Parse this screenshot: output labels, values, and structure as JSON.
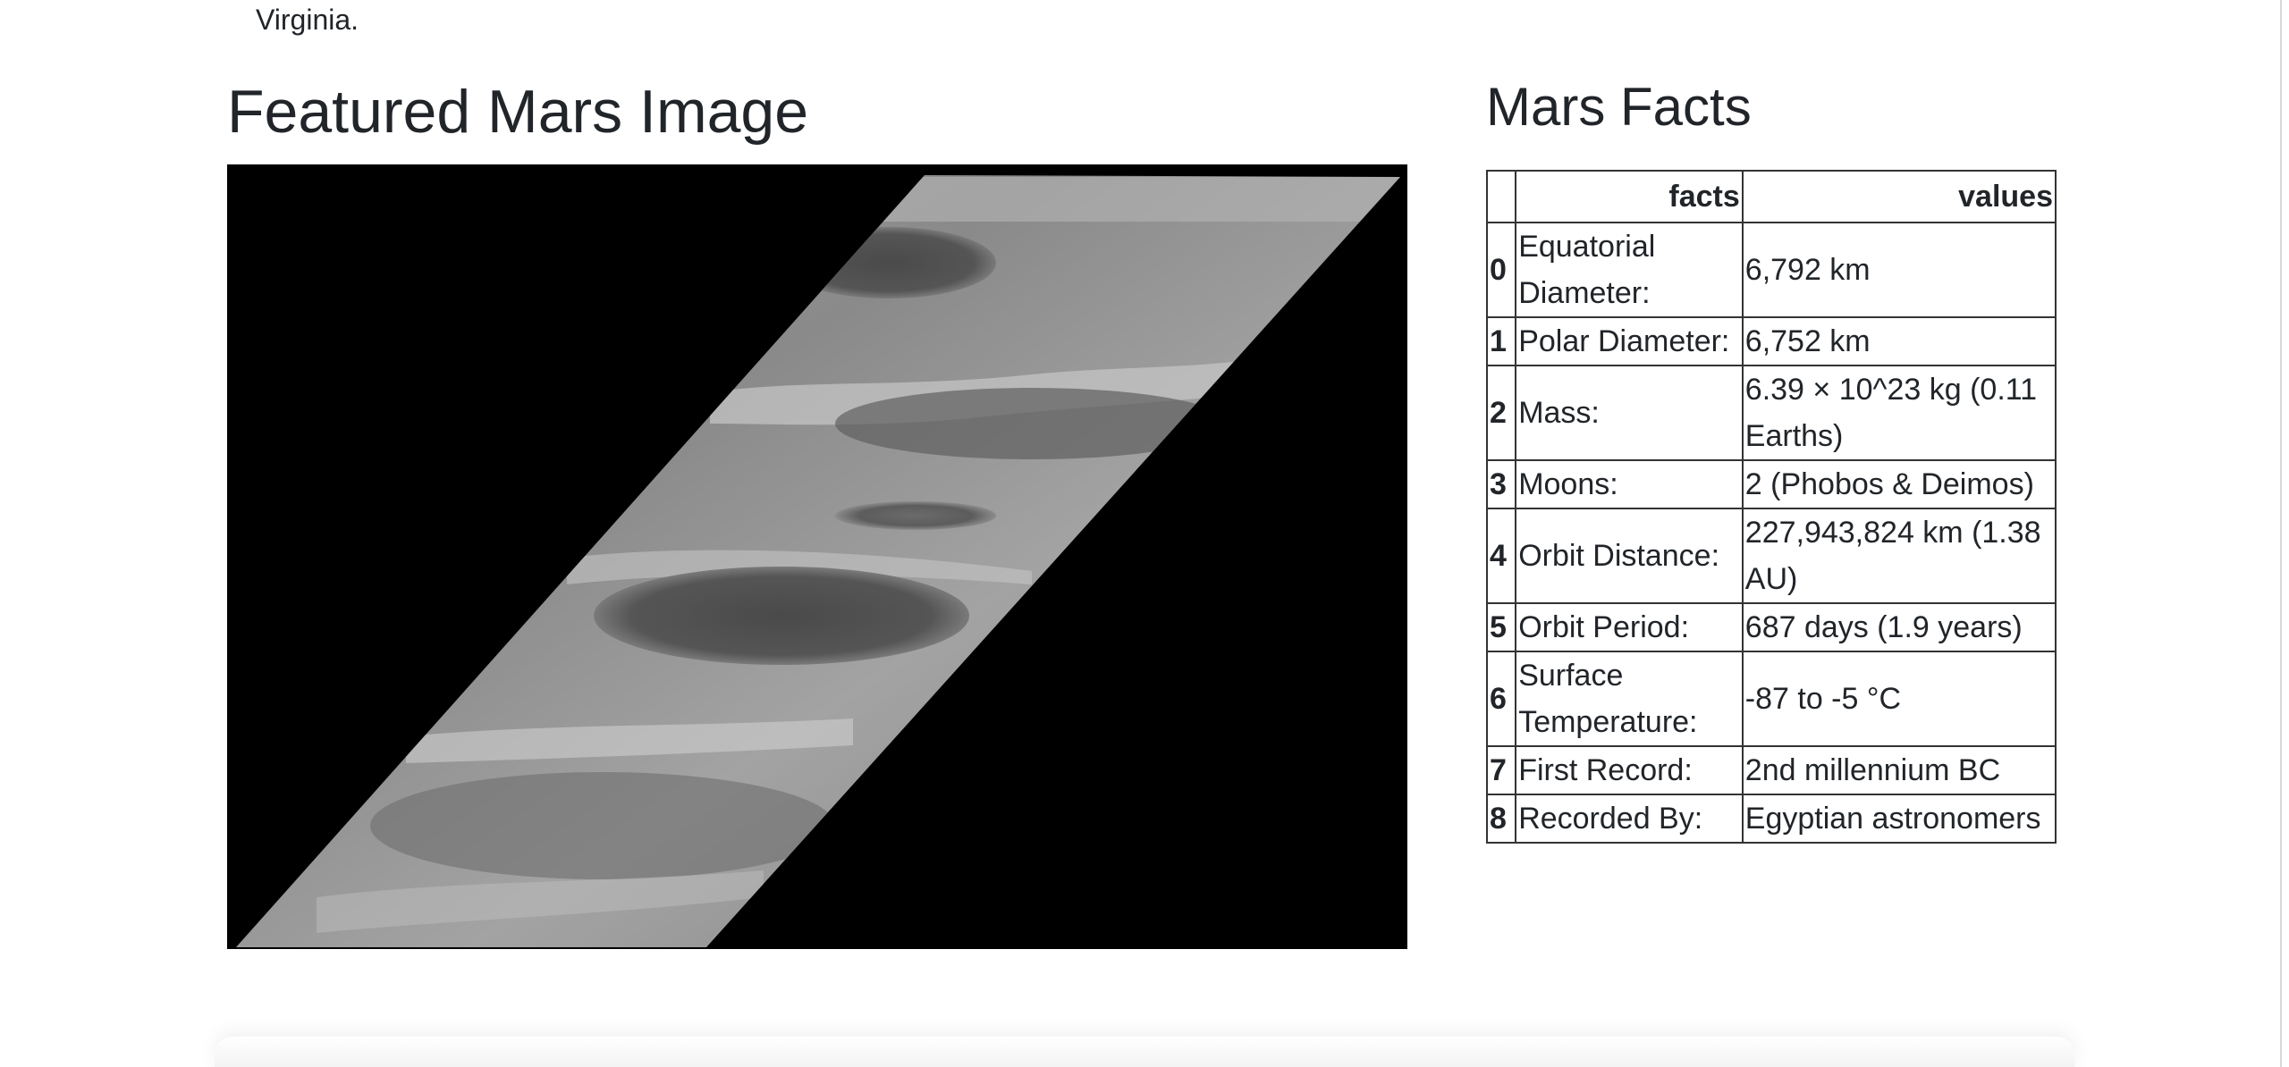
{
  "intro": {
    "tail_text": "Virginia."
  },
  "featured": {
    "title": "Featured Mars Image"
  },
  "facts": {
    "title": "Mars Facts",
    "headers": [
      "",
      "facts",
      "values"
    ],
    "rows": [
      {
        "index": "0",
        "fact": "Equatorial Diameter:",
        "value": "6,792 km"
      },
      {
        "index": "1",
        "fact": "Polar Diameter:",
        "value": "6,752 km"
      },
      {
        "index": "2",
        "fact": "Mass:",
        "value": "6.39 × 10^23 kg (0.11 Earths)"
      },
      {
        "index": "3",
        "fact": "Moons:",
        "value": "2 (Phobos & Deimos)"
      },
      {
        "index": "4",
        "fact": "Orbit Distance:",
        "value": "227,943,824 km (1.38 AU)"
      },
      {
        "index": "5",
        "fact": "Orbit Period:",
        "value": "687 days (1.9 years)"
      },
      {
        "index": "6",
        "fact": "Surface Temperature:",
        "value": "-87 to -5 °C"
      },
      {
        "index": "7",
        "fact": "First Record:",
        "value": "2nd millennium BC"
      },
      {
        "index": "8",
        "fact": "Recorded By:",
        "value": "Egyptian astronomers"
      }
    ]
  },
  "colors": {
    "text": "#212529",
    "table_border": "#333333",
    "image_background": "#000000"
  }
}
